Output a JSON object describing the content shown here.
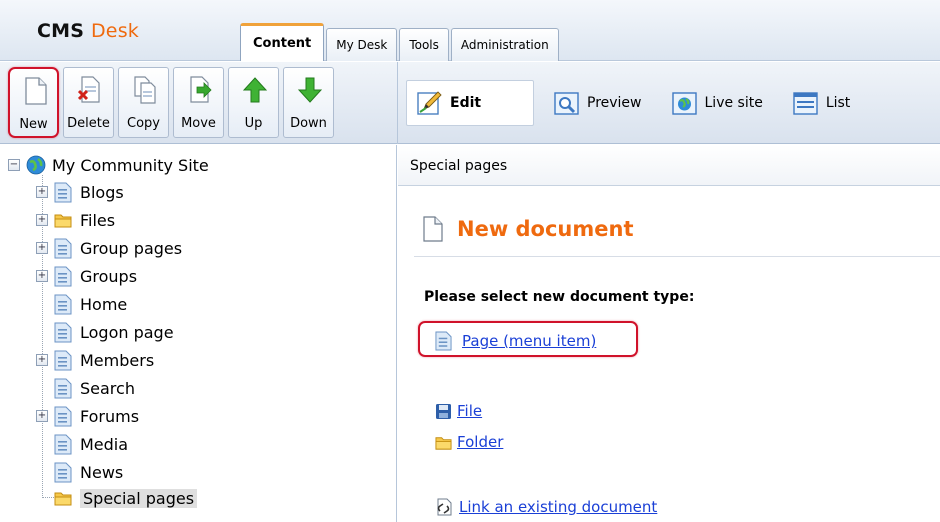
{
  "header": {
    "brand_cms": "CMS",
    "brand_desk": "Desk",
    "tabs": [
      {
        "label": "Content",
        "active": true
      },
      {
        "label": "My Desk"
      },
      {
        "label": "Tools"
      },
      {
        "label": "Administration"
      }
    ]
  },
  "toolbar": {
    "actions": [
      {
        "label": "New",
        "icon": "new-document-icon",
        "highlighted": true
      },
      {
        "label": "Delete",
        "icon": "delete-document-icon"
      },
      {
        "label": "Copy",
        "icon": "copy-document-icon"
      },
      {
        "label": "Move",
        "icon": "move-document-icon"
      },
      {
        "label": "Up",
        "icon": "up-arrow-icon"
      },
      {
        "label": "Down",
        "icon": "down-arrow-icon"
      }
    ],
    "views": [
      {
        "label": "Edit",
        "icon": "edit-pencil-icon",
        "active": true
      },
      {
        "label": "Preview",
        "icon": "preview-magnifier-icon"
      },
      {
        "label": "Live site",
        "icon": "live-site-globe-icon"
      },
      {
        "label": "List",
        "icon": "list-icon"
      }
    ]
  },
  "tree": {
    "root": "My Community Site",
    "items": [
      {
        "label": "Blogs",
        "expandable": true,
        "icon": "page-icon"
      },
      {
        "label": "Files",
        "expandable": true,
        "icon": "folder-icon"
      },
      {
        "label": "Group pages",
        "expandable": true,
        "icon": "page-icon"
      },
      {
        "label": "Groups",
        "expandable": true,
        "icon": "page-icon"
      },
      {
        "label": "Home",
        "expandable": false,
        "icon": "page-icon"
      },
      {
        "label": "Logon page",
        "expandable": false,
        "icon": "page-icon"
      },
      {
        "label": "Members",
        "expandable": true,
        "icon": "page-icon"
      },
      {
        "label": "Search",
        "expandable": false,
        "icon": "page-icon"
      },
      {
        "label": "Forums",
        "expandable": true,
        "icon": "page-icon"
      },
      {
        "label": "Media",
        "expandable": false,
        "icon": "page-icon"
      },
      {
        "label": "News",
        "expandable": false,
        "icon": "page-icon"
      },
      {
        "label": "Special pages",
        "expandable": false,
        "icon": "folder-icon",
        "selected": true
      }
    ]
  },
  "content": {
    "breadcrumb": "Special pages",
    "title": "New document",
    "prompt": "Please select new document type:",
    "types": [
      {
        "label": "Page (menu item)",
        "icon": "page-icon",
        "highlighted": true
      },
      {
        "label": "File",
        "icon": "floppy-disk-icon"
      },
      {
        "label": "Folder",
        "icon": "folder-icon"
      },
      {
        "label": "Link an existing document",
        "icon": "link-document-icon"
      }
    ]
  },
  "colors": {
    "brand_orange": "#ef6a0f",
    "link_blue": "#1a3fd6",
    "highlight_red": "#d0122a",
    "tab_accent": "#f0a23a"
  }
}
